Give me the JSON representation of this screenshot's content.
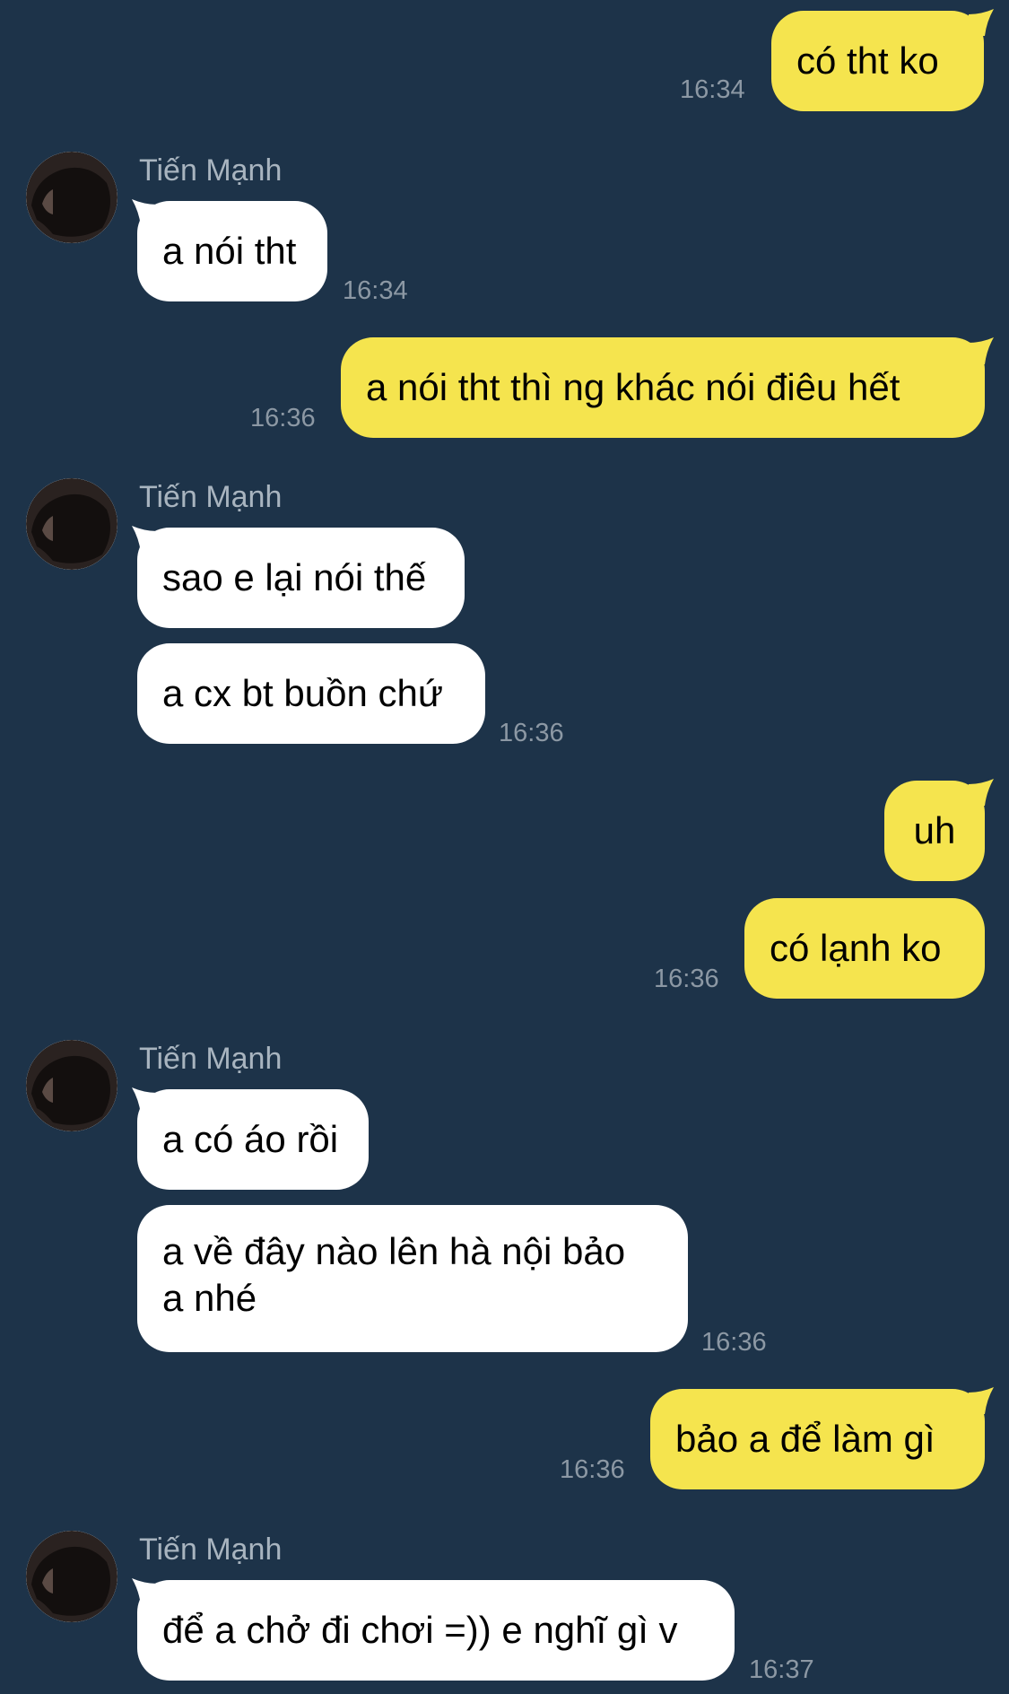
{
  "contact": {
    "name": "Tiến Mạnh"
  },
  "colors": {
    "background": "#1d3349",
    "outgoing_bubble": "#f5e44e",
    "incoming_bubble": "#ffffff",
    "timestamp": "#8c98a4",
    "sender_name": "#a8b4bf"
  },
  "messages": [
    {
      "text": "có tht ko",
      "time": "16:34"
    },
    {
      "text": "a nói tht",
      "time": "16:34"
    },
    {
      "text": "a nói tht thì ng khác nói điêu hết",
      "time": "16:36"
    },
    {
      "text": "sao e lại nói thế"
    },
    {
      "text": "a cx bt buồn chứ",
      "time": "16:36"
    },
    {
      "text": "uh"
    },
    {
      "text": "có lạnh ko",
      "time": "16:36"
    },
    {
      "text": "a có áo rồi"
    },
    {
      "text_line1": "a về đây nào lên hà nội bảo",
      "text_line2": "a nhé",
      "time": "16:36"
    },
    {
      "text": "bảo a để làm gì",
      "time": "16:36"
    },
    {
      "text": "để a chở đi chơi =)) e nghĩ gì v",
      "time": "16:37"
    }
  ]
}
